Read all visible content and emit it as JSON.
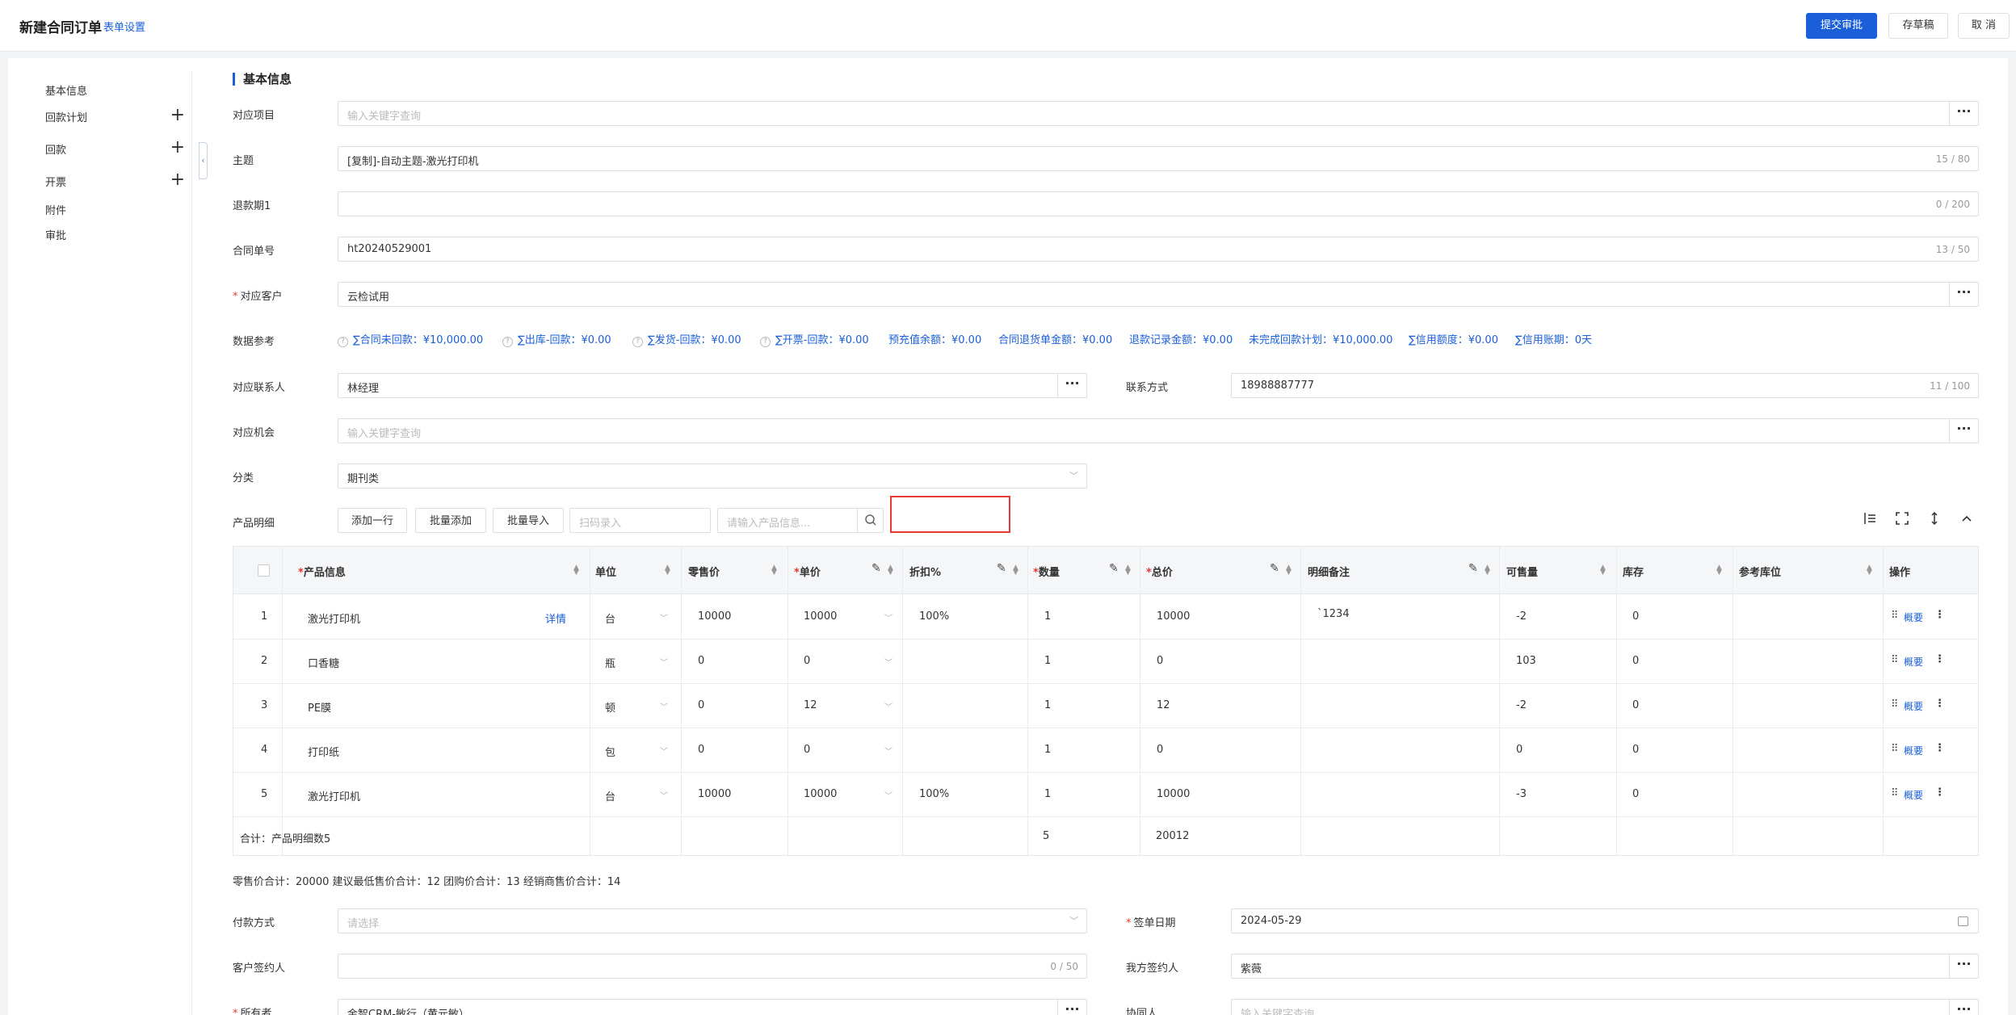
{
  "header": {
    "title": "新建合同订单",
    "settings": "表单设置",
    "submit": "提交审批",
    "draft": "存草稿",
    "cancel": "取 消"
  },
  "nav": {
    "items": [
      "基本信息",
      "回款计划",
      "回款",
      "开票",
      "附件",
      "审批"
    ]
  },
  "section": {
    "title": "基本信息"
  },
  "form": {
    "project": {
      "label": "对应项目",
      "placeholder": "输入关键字查询"
    },
    "subject": {
      "label": "主题",
      "value": "[复制]-自动主题-激光打印机",
      "count": "15 / 80"
    },
    "refund": {
      "label": "退款期1",
      "value": "",
      "count": "0 / 200"
    },
    "contract_no": {
      "label": "合同单号",
      "value": "ht20240529001",
      "count": "13 / 50"
    },
    "customer": {
      "label": "对应客户",
      "value": "云检试用"
    },
    "dataref_label": "数据参考",
    "dataref": [
      "∑合同未回款：¥10,000.00",
      "∑出库-回款：¥0.00",
      "∑发货-回款：¥0.00",
      "∑开票-回款：¥0.00",
      "预充值余额：¥0.00",
      "合同退货单金额：¥0.00",
      "退款记录金额：¥0.00",
      "未完成回款计划：¥10,000.00",
      "∑信用额度：¥0.00",
      "∑信用账期：0天"
    ],
    "contact": {
      "label": "对应联系人",
      "value": "林经理"
    },
    "phone": {
      "label": "联系方式",
      "value": "18988887777",
      "count": "11 / 100"
    },
    "opportunity": {
      "label": "对应机会",
      "placeholder": "输入关键字查询"
    },
    "category": {
      "label": "分类",
      "value": "期刊类"
    },
    "products": {
      "label": "产品明细",
      "add_row": "添加一行",
      "batch_add": "批量添加",
      "batch_import": "批量导入",
      "scan_placeholder": "扫码录入",
      "search_placeholder": "请输入产品信息..."
    },
    "payment": {
      "label": "付款方式",
      "placeholder": "请选择"
    },
    "sign_date": {
      "label": "签单日期",
      "value": "2024-05-29"
    },
    "customer_signer": {
      "label": "客户签约人",
      "value": "",
      "count": "0 / 50"
    },
    "our_signer": {
      "label": "我方签约人",
      "value": "紫薇"
    },
    "owner": {
      "label": "所有者",
      "value": "金智CRM-敏行（黄元敏）"
    },
    "collaborator": {
      "label": "协同人",
      "placeholder": "输入关键字查询"
    }
  },
  "table": {
    "headers": {
      "product": "产品信息",
      "unit": "单位",
      "retail": "零售价",
      "price": "单价",
      "discount": "折扣%",
      "qty": "数量",
      "total": "总价",
      "remark": "明细备注",
      "sellable": "可售量",
      "stock": "库存",
      "ref_stock": "参考库位",
      "ops": "操作"
    },
    "detail_link": "详情",
    "summary_link": "概要",
    "rows": [
      {
        "no": "1",
        "product": "激光打印机",
        "unit": "台",
        "retail": "10000",
        "price": "10000",
        "discount": "100%",
        "qty": "1",
        "total": "10000",
        "remark": "`1234",
        "sellable": "-2",
        "stock": "0"
      },
      {
        "no": "2",
        "product": "口香糖",
        "unit": "瓶",
        "retail": "0",
        "price": "0",
        "discount": "",
        "qty": "1",
        "total": "0",
        "remark": "",
        "sellable": "103",
        "stock": "0"
      },
      {
        "no": "3",
        "product": "PE膜",
        "unit": "顿",
        "retail": "0",
        "price": "12",
        "discount": "",
        "qty": "1",
        "total": "12",
        "remark": "",
        "sellable": "-2",
        "stock": "0"
      },
      {
        "no": "4",
        "product": "打印纸",
        "unit": "包",
        "retail": "0",
        "price": "0",
        "discount": "",
        "qty": "1",
        "total": "0",
        "remark": "",
        "sellable": "0",
        "stock": "0"
      },
      {
        "no": "5",
        "product": "激光打印机",
        "unit": "台",
        "retail": "10000",
        "price": "10000",
        "discount": "100%",
        "qty": "1",
        "total": "10000",
        "remark": "",
        "sellable": "-3",
        "stock": "0"
      }
    ],
    "footer": {
      "label": "合计：产品明细数5",
      "qty": "5",
      "total": "20012"
    }
  },
  "summary": "零售价合计：20000  建议最低售价合计：12  团购价合计：13  经销商售价合计：14"
}
